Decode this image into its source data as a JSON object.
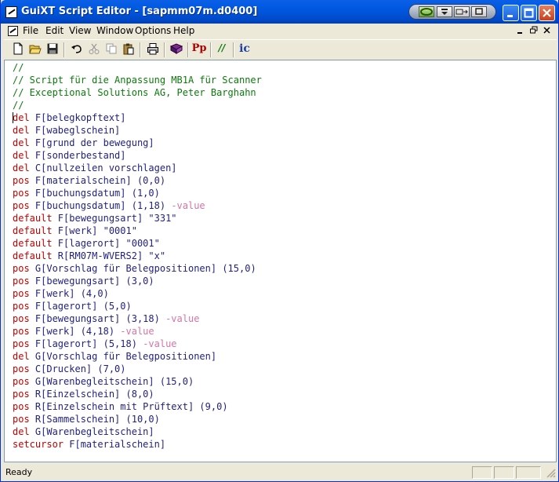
{
  "window": {
    "title": "GuiXT Script Editor - [sapmm07m.d0400]"
  },
  "menu": [
    "File",
    "Edit",
    "View",
    "Window",
    "Options",
    "Help"
  ],
  "toolbar": {
    "icons": [
      "new-file-icon",
      "open-folder-icon",
      "save-icon",
      "undo-icon",
      "cut-icon",
      "copy-icon",
      "paste-icon",
      "print-icon",
      "book-icon",
      "pp-icon",
      "comment-icon",
      "ic-icon"
    ],
    "pp_label": "Pp",
    "comment_label": "//",
    "ic_label": "ic"
  },
  "colors": {
    "keyword": "#C00000",
    "comment": "#0B7A0B",
    "option": "#D474A8",
    "text": "#1F1F80",
    "title_bar": "#0058E0"
  },
  "code_lines": [
    [
      {
        "t": "//",
        "c": "comment"
      }
    ],
    [
      {
        "t": "// Script für die Anpassung MB1A für Scanner",
        "c": "comment"
      }
    ],
    [
      {
        "t": "// Exceptional Solutions AG, Peter Barghahn",
        "c": "comment"
      }
    ],
    [
      {
        "t": "//",
        "c": "comment"
      }
    ],
    [
      {
        "t": "del",
        "c": "kw"
      },
      {
        "t": " F[belegkopftext]",
        "c": "id"
      }
    ],
    [
      {
        "t": "del",
        "c": "kw"
      },
      {
        "t": " F[wabeglschein]",
        "c": "id"
      }
    ],
    [
      {
        "t": "del",
        "c": "kw"
      },
      {
        "t": " F[grund der bewegung]",
        "c": "id"
      }
    ],
    [
      {
        "t": "del",
        "c": "kw"
      },
      {
        "t": " F[sonderbestand]",
        "c": "id"
      }
    ],
    [
      {
        "t": "del",
        "c": "kw"
      },
      {
        "t": " C[nullzeilen vorschlagen]",
        "c": "id"
      }
    ],
    [
      {
        "t": "pos",
        "c": "kw"
      },
      {
        "t": " F[materialschein] (0,0)",
        "c": "id"
      }
    ],
    [
      {
        "t": "pos",
        "c": "kw"
      },
      {
        "t": " F[buchungsdatum] (1,0)",
        "c": "id"
      }
    ],
    [
      {
        "t": "pos",
        "c": "kw"
      },
      {
        "t": " F[buchungsdatum] (1,18) ",
        "c": "id"
      },
      {
        "t": "-value",
        "c": "opt"
      }
    ],
    [
      {
        "t": "default",
        "c": "kw"
      },
      {
        "t": " F[bewegungsart] \"331\"",
        "c": "id"
      }
    ],
    [
      {
        "t": "default",
        "c": "kw"
      },
      {
        "t": " F[werk] \"0001\"",
        "c": "id"
      }
    ],
    [
      {
        "t": "default",
        "c": "kw"
      },
      {
        "t": " F[lagerort] \"0001\"",
        "c": "id"
      }
    ],
    [
      {
        "t": "default",
        "c": "kw"
      },
      {
        "t": " R[RM07M-WVERS2] \"x\"",
        "c": "id"
      }
    ],
    [
      {
        "t": "pos",
        "c": "kw"
      },
      {
        "t": " G[Vorschlag für Belegpositionen] (15,0)",
        "c": "id"
      }
    ],
    [
      {
        "t": "pos",
        "c": "kw"
      },
      {
        "t": " F[bewegungsart] (3,0)",
        "c": "id"
      }
    ],
    [
      {
        "t": "pos",
        "c": "kw"
      },
      {
        "t": " F[werk] (4,0)",
        "c": "id"
      }
    ],
    [
      {
        "t": "pos",
        "c": "kw"
      },
      {
        "t": " F[lagerort] (5,0)",
        "c": "id"
      }
    ],
    [
      {
        "t": "pos",
        "c": "kw"
      },
      {
        "t": " F[bewegungsart] (3,18) ",
        "c": "id"
      },
      {
        "t": "-value",
        "c": "opt"
      }
    ],
    [
      {
        "t": "pos",
        "c": "kw"
      },
      {
        "t": " F[werk] (4,18) ",
        "c": "id"
      },
      {
        "t": "-value",
        "c": "opt"
      }
    ],
    [
      {
        "t": "pos",
        "c": "kw"
      },
      {
        "t": " F[lagerort] (5,18) ",
        "c": "id"
      },
      {
        "t": "-value",
        "c": "opt"
      }
    ],
    [
      {
        "t": "del",
        "c": "kw"
      },
      {
        "t": " G[Vorschlag für Belegpositionen]",
        "c": "id"
      }
    ],
    [
      {
        "t": "pos",
        "c": "kw"
      },
      {
        "t": " C[Drucken] (7,0)",
        "c": "id"
      }
    ],
    [
      {
        "t": "pos",
        "c": "kw"
      },
      {
        "t": " G[Warenbegleitschein] (15,0)",
        "c": "id"
      }
    ],
    [
      {
        "t": "pos",
        "c": "kw"
      },
      {
        "t": " R[Einzelschein] (8,0)",
        "c": "id"
      }
    ],
    [
      {
        "t": "pos",
        "c": "kw"
      },
      {
        "t": " R[Einzelschein mit Prüftext] (9,0)",
        "c": "id"
      }
    ],
    [
      {
        "t": "pos",
        "c": "kw"
      },
      {
        "t": " R[Sammelschein] (10,0)",
        "c": "id"
      }
    ],
    [
      {
        "t": "del",
        "c": "kw"
      },
      {
        "t": " G[Warenbegleitschein]",
        "c": "id"
      }
    ],
    [
      {
        "t": "setcursor",
        "c": "kw"
      },
      {
        "t": " F[materialschein]",
        "c": "id"
      }
    ]
  ],
  "status": {
    "text": "Ready"
  }
}
